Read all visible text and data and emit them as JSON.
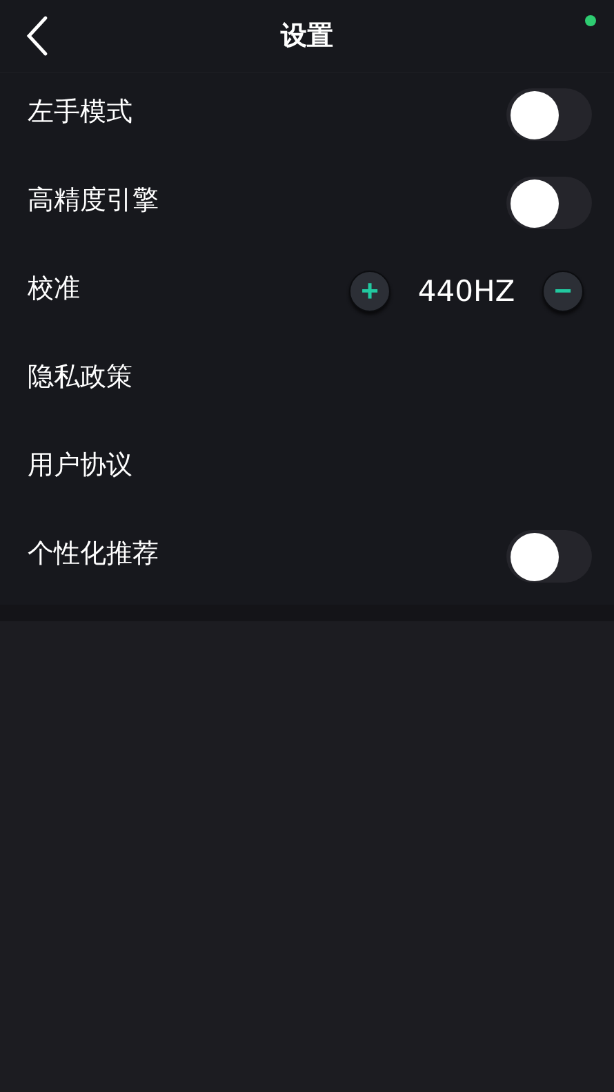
{
  "header": {
    "title": "设置"
  },
  "rows": [
    {
      "kind": "toggle",
      "label": "左手模式",
      "on": false
    },
    {
      "kind": "toggle",
      "label": "高精度引擎",
      "on": false
    },
    {
      "kind": "stepper",
      "label": "校准",
      "plus": "+",
      "value": "440HZ",
      "minus": "−"
    },
    {
      "kind": "link",
      "label": "隐私政策"
    },
    {
      "kind": "link",
      "label": "用户协议"
    },
    {
      "kind": "toggle",
      "label": "个性化推荐",
      "on": false
    }
  ]
}
